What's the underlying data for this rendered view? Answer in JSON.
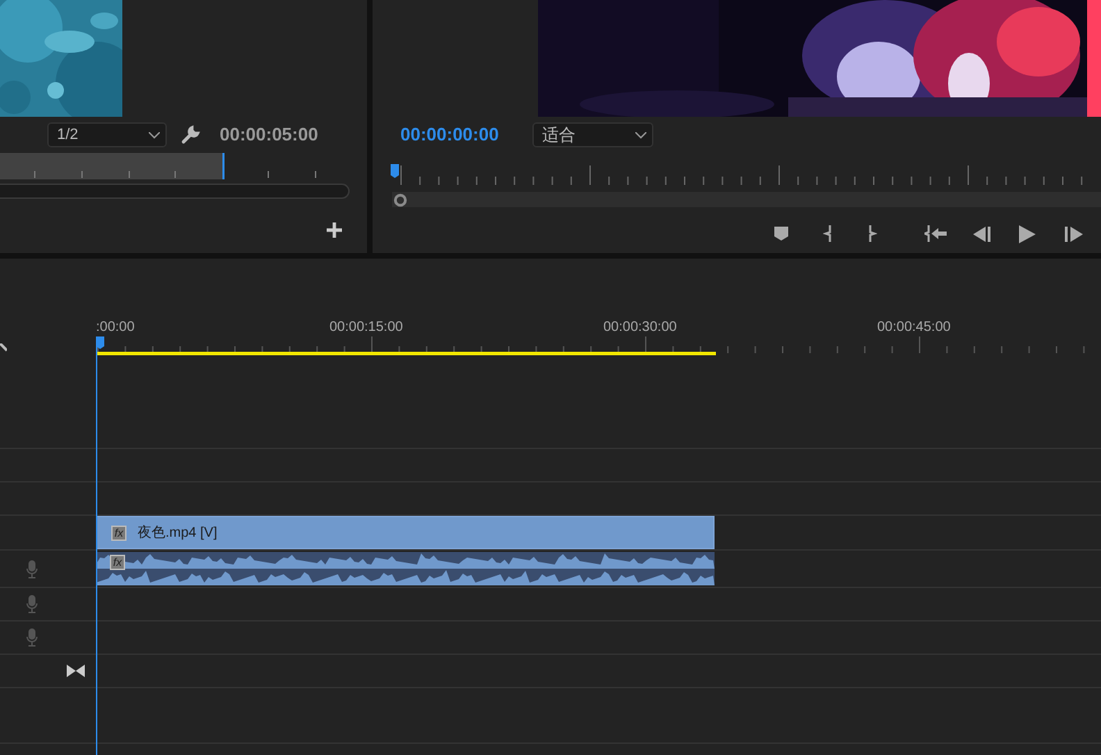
{
  "source_monitor": {
    "resolution": "1/2",
    "timecode": "00:00:05:00"
  },
  "program_monitor": {
    "timecode": "00:00:00:00",
    "zoom": "适合"
  },
  "timeline": {
    "ruler_labels": [
      ":00:00",
      "00:00:15:00",
      "00:00:30:00",
      "00:00:45:00"
    ],
    "clips": [
      {
        "kind": "video",
        "name": "夜色.mp4 [V]",
        "badge": "fx"
      },
      {
        "kind": "audio",
        "badge": "fx"
      }
    ]
  }
}
